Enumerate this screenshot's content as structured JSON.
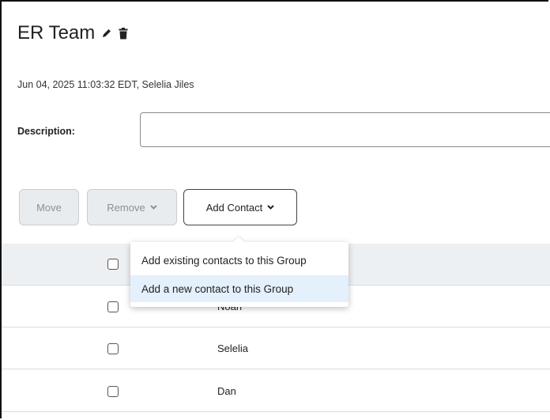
{
  "group": {
    "title": "ER Team",
    "meta": "Jun 04, 2025 11:03:32 EDT, Selelia Jiles"
  },
  "description": {
    "label": "Description:",
    "value": ""
  },
  "toolbar": {
    "move_label": "Move",
    "remove_label": "Remove",
    "add_contact_label": "Add Contact"
  },
  "dropdown": {
    "items": [
      {
        "label": "Add existing contacts to this Group"
      },
      {
        "label": "Add a new contact to this Group"
      }
    ]
  },
  "rows": [
    {
      "name": "Noah"
    },
    {
      "name": "Selelia"
    },
    {
      "name": "Dan"
    }
  ],
  "icons": {
    "edit": "pencil-icon",
    "delete": "trash-icon",
    "chevron": "chevron-down-icon"
  }
}
